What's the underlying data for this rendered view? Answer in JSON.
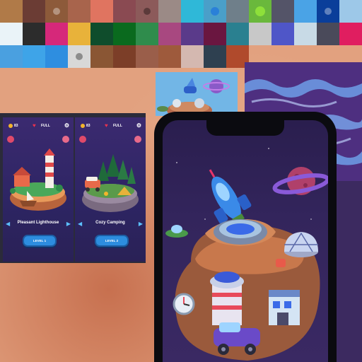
{
  "swatches": {
    "row1": [
      "#b07a48",
      "#6b3c34",
      "#8d5a3a",
      "#a8644c",
      "#e07460",
      "#8a4a52",
      "#8c5a5a",
      "#9b8a86",
      "#2fb8d8",
      "#4a9fc9",
      "#6f7f8a",
      "#6ab83c",
      "#545468",
      "#4aa3e6",
      "#0a3e9a",
      "#9dc8e8"
    ],
    "row2": [
      "#eaf3f8",
      "#2c2c2c",
      "#d6287a",
      "#e8b23a",
      "#0f4d2c",
      "#0a6a1e",
      "#2f8c4c",
      "#a84880",
      "#5a3a8a",
      "#6a1640",
      "#2a8090",
      "#c8c8c8",
      "#4f56c8",
      "#c8dae6",
      "#4a4a5a",
      "#e01e60"
    ],
    "row3": [
      "#4aa0e0",
      "#3ea4e8",
      "#2e8ee0",
      "#d8d8d8",
      "#8a5634",
      "#7c3e28",
      "#9a5e4a",
      "#9e5a3c",
      "#d4b8b0",
      "#2e4050",
      "#b04a2c",
      "#ffffff",
      "#eeeeee",
      "#e8e8e8",
      "#e8a888",
      "#e8a888"
    ]
  },
  "colors": {
    "background": "#e2a17f",
    "screen_bg": "#33255c",
    "button_blue": "#2d8ddf",
    "heart_red": "#e8324f",
    "coin_gold": "#f4b52b"
  },
  "screenshots": [
    {
      "coins": "83",
      "lives_status": "FULL",
      "level_name": "Pleasant Lighthouse",
      "play_button": "LEVEL 1"
    },
    {
      "coins": "83",
      "lives_status": "FULL",
      "level_name": "Cozy Camping",
      "play_button": "LEVEL 2"
    }
  ],
  "icons": {
    "coin": "coin-icon",
    "heart": "heart-icon",
    "settings": "gear-icon",
    "arrow_left": "arrow-left-icon",
    "arrow_right": "arrow-right-icon"
  }
}
